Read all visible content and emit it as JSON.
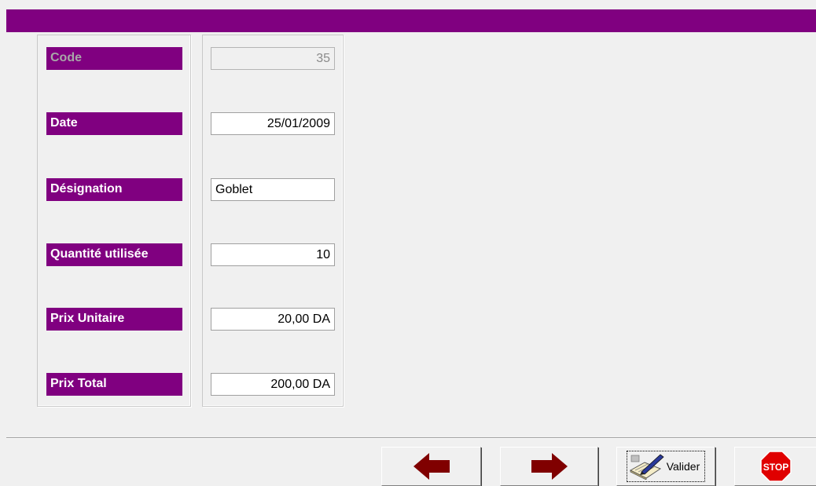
{
  "form": {
    "fields": [
      {
        "label": "Code",
        "value": "35",
        "readonly": true
      },
      {
        "label": "Date",
        "value": "25/01/2009"
      },
      {
        "label": "Désignation",
        "value": "Goblet"
      },
      {
        "label": "Quantité utilisée",
        "value": "10"
      },
      {
        "label": "Prix Unitaire",
        "value": "20,00 DA"
      },
      {
        "label": "Prix Total",
        "value": "200,00 DA"
      }
    ]
  },
  "toolbar": {
    "valider_label": "Valider",
    "stop_label": "STOP"
  },
  "colors": {
    "accent": "#800080",
    "arrow": "#800000",
    "stop": "#e00000"
  },
  "icons": {
    "previous": "arrow-left-icon",
    "next": "arrow-right-icon",
    "validate": "pen-notebook-icon",
    "stop": "stop-sign-icon"
  }
}
